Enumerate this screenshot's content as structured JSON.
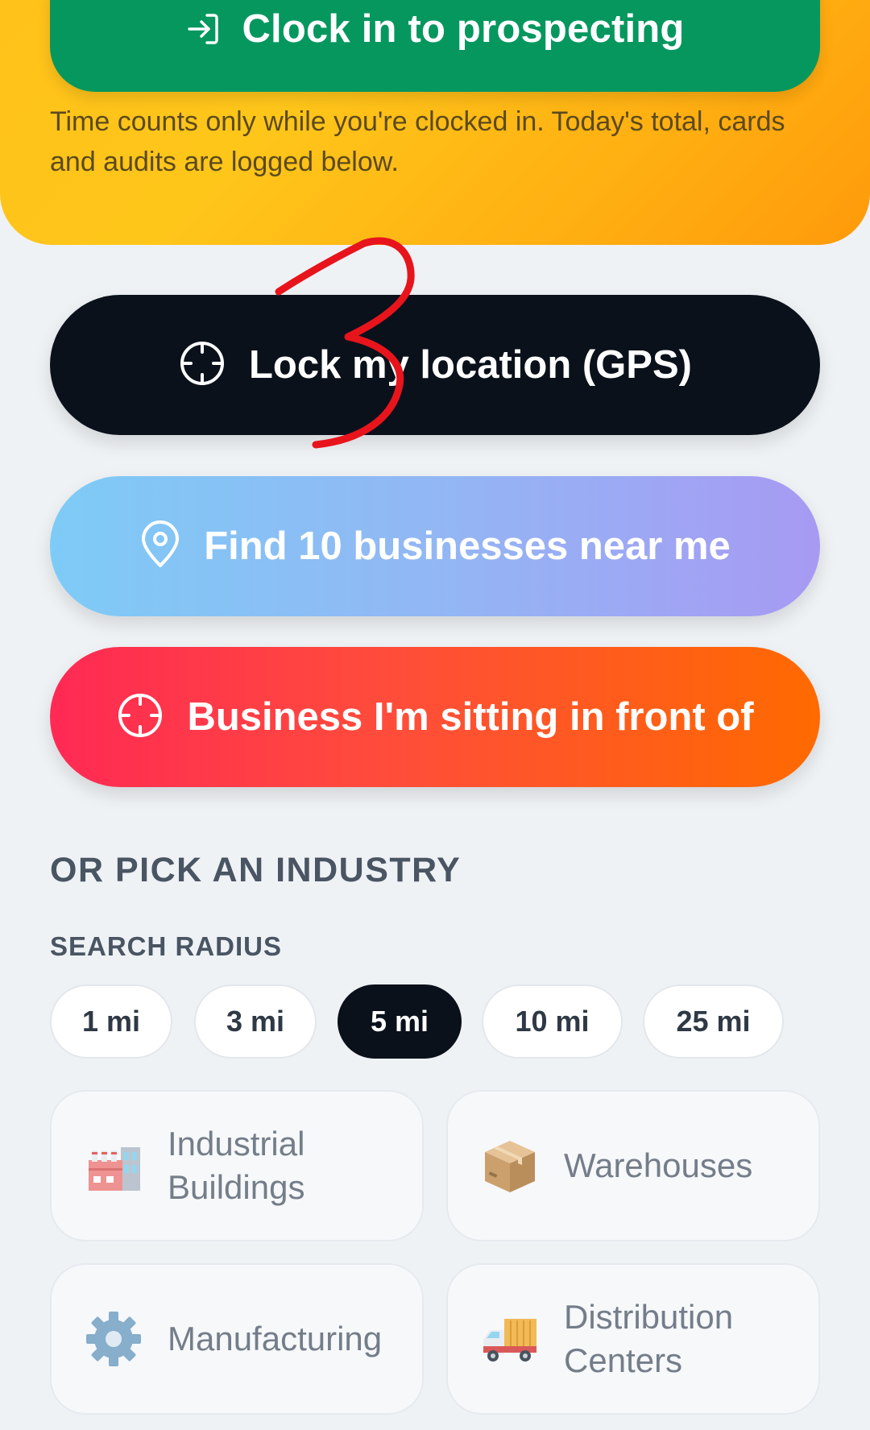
{
  "hero": {
    "clock_in_label": "Clock in to prospecting",
    "note": "Time counts only while you're clocked in. Today's total, cards and audits are logged below."
  },
  "actions": {
    "lock_location": "Lock my location (GPS)",
    "find_nearby": "Find 10 businesses near me",
    "in_front_of": "Business I'm sitting in front of"
  },
  "industry": {
    "title": "OR PICK AN INDUSTRY",
    "radius_label": "SEARCH RADIUS",
    "radius_options": [
      "1 mi",
      "3 mi",
      "5 mi",
      "10 mi",
      "25 mi"
    ],
    "selected_radius": "5 mi",
    "cards": [
      {
        "label": "Industrial Buildings",
        "icon": "factory-icon"
      },
      {
        "label": "Warehouses",
        "icon": "package-icon"
      },
      {
        "label": "Manufacturing",
        "icon": "gear-icon"
      },
      {
        "label": "Distribution Centers",
        "icon": "delivery-truck-icon"
      }
    ]
  },
  "annotation": {
    "text": "3",
    "color": "#e8141c"
  },
  "colors": {
    "clock_green": "#06975f",
    "gps_black": "#0a111b",
    "hero_amber": "#ffc21a"
  }
}
